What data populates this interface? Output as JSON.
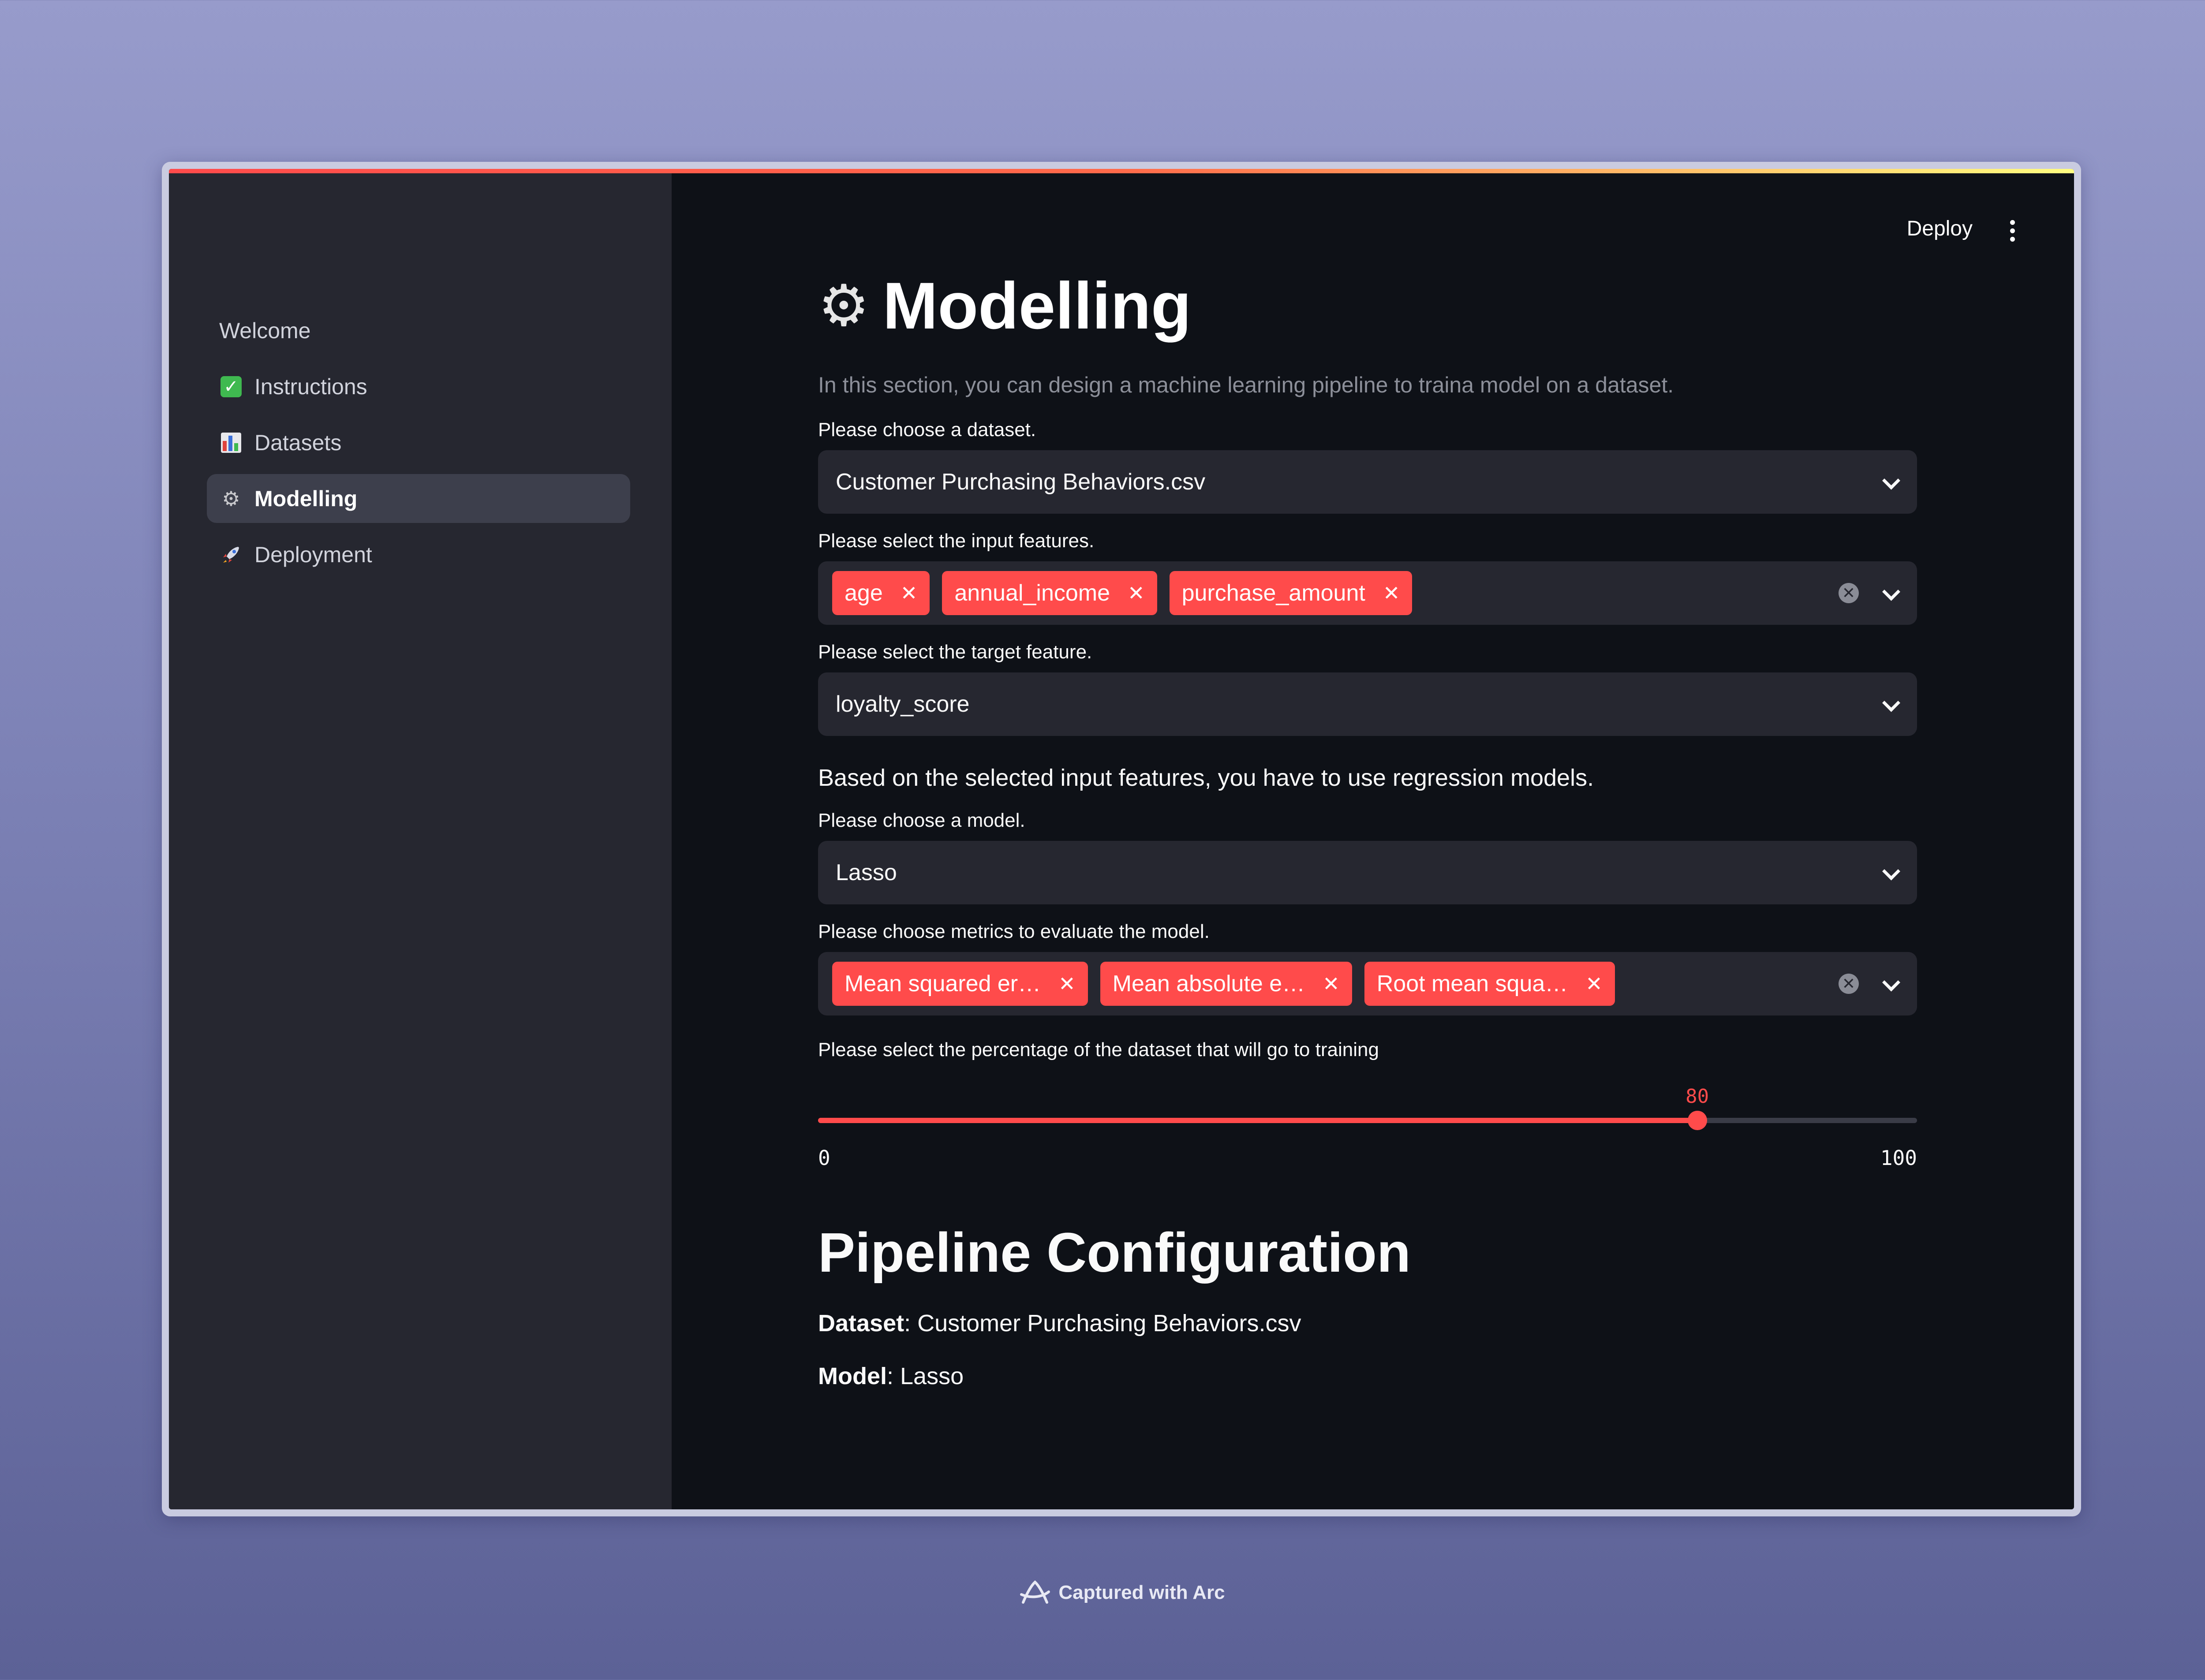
{
  "header": {
    "deploy_label": "Deploy"
  },
  "sidebar": {
    "items": [
      {
        "label": "Welcome",
        "icon": "none"
      },
      {
        "label": "Instructions",
        "icon": "check-mark-icon"
      },
      {
        "label": "Datasets",
        "icon": "bar-chart-icon"
      },
      {
        "label": "Modelling",
        "icon": "gear-icon",
        "active": true
      },
      {
        "label": "Deployment",
        "icon": "rocket-icon"
      }
    ]
  },
  "main": {
    "title": "Modelling",
    "subtitle": "In this section, you can design a machine learning pipeline to traina model on a dataset.",
    "dataset": {
      "label": "Please choose a dataset.",
      "value": "Customer Purchasing Behaviors.csv"
    },
    "input_features": {
      "label": "Please select the input features.",
      "tags": [
        "age",
        "annual_income",
        "purchase_amount"
      ]
    },
    "target_feature": {
      "label": "Please select the target feature.",
      "value": "loyalty_score"
    },
    "info": "Based on the selected input features, you have to use regression models.",
    "model": {
      "label": "Please choose a model.",
      "value": "Lasso"
    },
    "metrics": {
      "label": "Please choose metrics to evaluate the model.",
      "tags": [
        "Mean squared er…",
        "Mean absolute e…",
        "Root mean squa…"
      ]
    },
    "split": {
      "label": "Please select the percentage of the dataset that will go to training",
      "value": 80,
      "min": 0,
      "max": 100,
      "value_text": "80",
      "min_text": "0",
      "max_text": "100"
    },
    "pipeline": {
      "heading": "Pipeline Configuration",
      "dataset_key": "Dataset",
      "dataset_value": ": Customer Purchasing Behaviors.csv",
      "model_key": "Model",
      "model_value": ": Lasso"
    }
  },
  "footer": {
    "text": "Captured with Arc"
  },
  "colors": {
    "accent": "#ff4b4b",
    "bg": "#0e1117",
    "sidebar": "#262730",
    "widget": "#262730"
  }
}
